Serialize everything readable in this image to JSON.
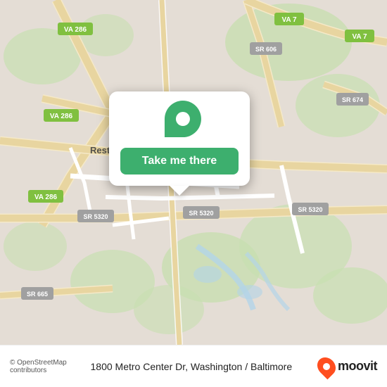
{
  "map": {
    "background_color": "#e8e0d8",
    "alt": "Map showing Reston area, Washington DC / Baltimore"
  },
  "popup": {
    "button_label": "Take me there"
  },
  "bottom_bar": {
    "osm_credit": "© OpenStreetMap contributors",
    "address": "1800 Metro Center Dr, Washington / Baltimore",
    "moovit_label": "moovit"
  },
  "pin": {
    "color": "#3daf6e"
  },
  "moovit_pin": {
    "color": "#ff4e1f"
  }
}
